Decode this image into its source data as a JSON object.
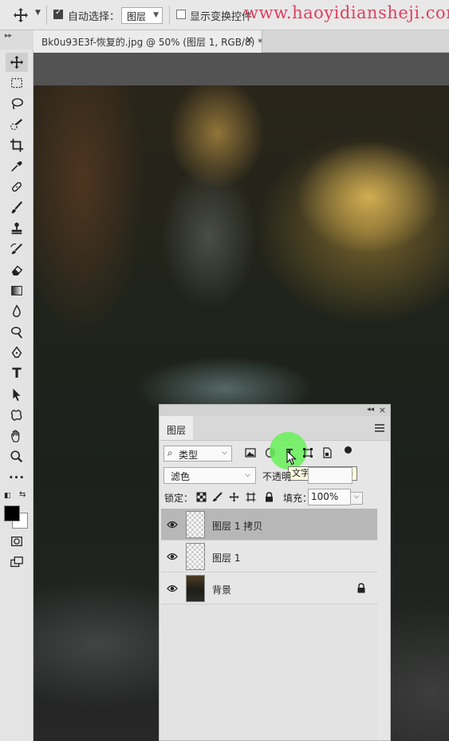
{
  "options_bar": {
    "auto_select_label": "自动选择：",
    "auto_select_checked": true,
    "auto_select_target": "图层",
    "show_transform_label": "显示变换控件",
    "show_transform_checked": false,
    "watermark": "www.haoyidiansheji.com"
  },
  "document": {
    "tab_title": "Bk0u93E3f-恢复的.jpg @ 50% (图层 1, RGB/8) *",
    "close_glyph": "×"
  },
  "tools": [
    {
      "icon": "move-icon",
      "active": true
    },
    {
      "icon": "marquee-icon"
    },
    {
      "icon": "lasso-icon"
    },
    {
      "icon": "quick-select-icon"
    },
    {
      "icon": "crop-icon"
    },
    {
      "icon": "eyedropper-icon"
    },
    {
      "icon": "healing-brush-icon"
    },
    {
      "icon": "brush-icon"
    },
    {
      "icon": "clone-stamp-icon"
    },
    {
      "icon": "history-brush-icon"
    },
    {
      "icon": "eraser-icon"
    },
    {
      "icon": "gradient-icon"
    },
    {
      "icon": "blur-icon"
    },
    {
      "icon": "dodge-icon"
    },
    {
      "icon": "pen-icon"
    },
    {
      "icon": "type-icon"
    },
    {
      "icon": "path-select-icon"
    },
    {
      "icon": "shape-icon"
    },
    {
      "icon": "hand-icon"
    },
    {
      "icon": "zoom-icon"
    },
    {
      "icon": "more-tools-icon"
    }
  ],
  "colors": {
    "foreground": "#000000",
    "background": "#ffffff",
    "watermark": "#e0405f",
    "highlight": "#6ef05f"
  },
  "layers_panel": {
    "tab_label": "图层",
    "filter_kind": "类型",
    "filter_tooltip": "文字图层过滤器",
    "blend_mode": "滤色",
    "opacity_label": "不透明",
    "lock_label": "锁定：",
    "fill_label": "填充：",
    "fill_value": "100%",
    "layers": [
      {
        "name": "图层 1 拷贝",
        "visible": true,
        "selected": true,
        "thumb": "transparent"
      },
      {
        "name": "图层 1",
        "visible": true,
        "selected": false,
        "thumb": "transparent"
      },
      {
        "name": "背景",
        "visible": true,
        "selected": false,
        "thumb": "photo",
        "locked": true
      }
    ]
  }
}
